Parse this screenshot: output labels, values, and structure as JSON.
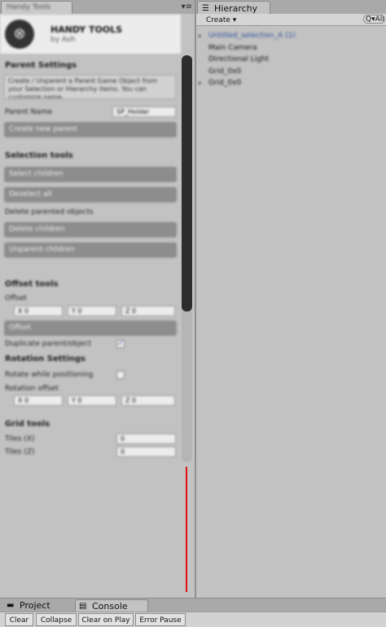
{
  "left_panel": {
    "tab_label": "Handy Tools",
    "menu_icon": "▾≡",
    "header": {
      "logo_glyph": "⊗",
      "title": "HANDY TOOLS",
      "subtitle": "by Ash"
    },
    "parent_settings": {
      "heading": "Parent Settings",
      "info": "Create / Unparent a Parent Game Object from your Selection or Hierarchy items. You can customize name...",
      "parent_name_label": "Parent Name",
      "parent_name_value": "SP_Holder",
      "create_button": "Create new parent"
    },
    "selection_tools": {
      "heading": "Selection tools",
      "buttons": [
        "Select children",
        "Deselect all"
      ],
      "sub_heading": "Delete parented objects",
      "buttons2": [
        "Delete children",
        "Unparent children"
      ]
    },
    "offset_tools": {
      "heading": "Offset tools",
      "offset_label": "Offset",
      "xyz": [
        "X 0",
        "Y 0",
        "Z 0"
      ],
      "apply_button": "Offset",
      "duplicate_label": "Duplicate parent/object",
      "duplicate_checked": true
    },
    "rotation_settings": {
      "heading": "Rotation Settings",
      "rotate_label": "Rotate while positioning",
      "rotation_offset_label": "Rotation offset",
      "xyz": [
        "X 0",
        "Y 0",
        "Z 0"
      ]
    },
    "grid_tools": {
      "heading": "Grid tools",
      "rows": [
        {
          "label": "Tiles (X)",
          "value": "0"
        },
        {
          "label": "Tiles (Z)",
          "value": "0"
        }
      ]
    },
    "scroll_fraction": 0.63
  },
  "hierarchy": {
    "tab_label": "Hierarchy",
    "tab_icon": "☰",
    "create_label": "Create ▾",
    "search_placeholder": "Q▾All",
    "items": [
      {
        "label": "Untitled_selection_A (1)",
        "expand": "▸",
        "highlight": true
      },
      {
        "label": "Main Camera",
        "expand": "",
        "highlight": false
      },
      {
        "label": "Directional Light",
        "expand": "",
        "highlight": false
      },
      {
        "label": "Grid_0x0",
        "expand": "",
        "highlight": false
      },
      {
        "label": "Grid_0x0",
        "expand": "▸",
        "highlight": false
      }
    ]
  },
  "bottom_tabs": {
    "project": {
      "icon": "▬",
      "label": "Project"
    },
    "console": {
      "icon": "▤",
      "label": "Console"
    }
  },
  "console_toolbar": {
    "buttons": [
      "Clear",
      "Collapse",
      "Clear on Play",
      "Error Pause"
    ]
  },
  "colors": {
    "highlight_text": "#2b4f9a",
    "scroll_thumb": "#2d2d2d",
    "marker_line": "#e01010"
  }
}
